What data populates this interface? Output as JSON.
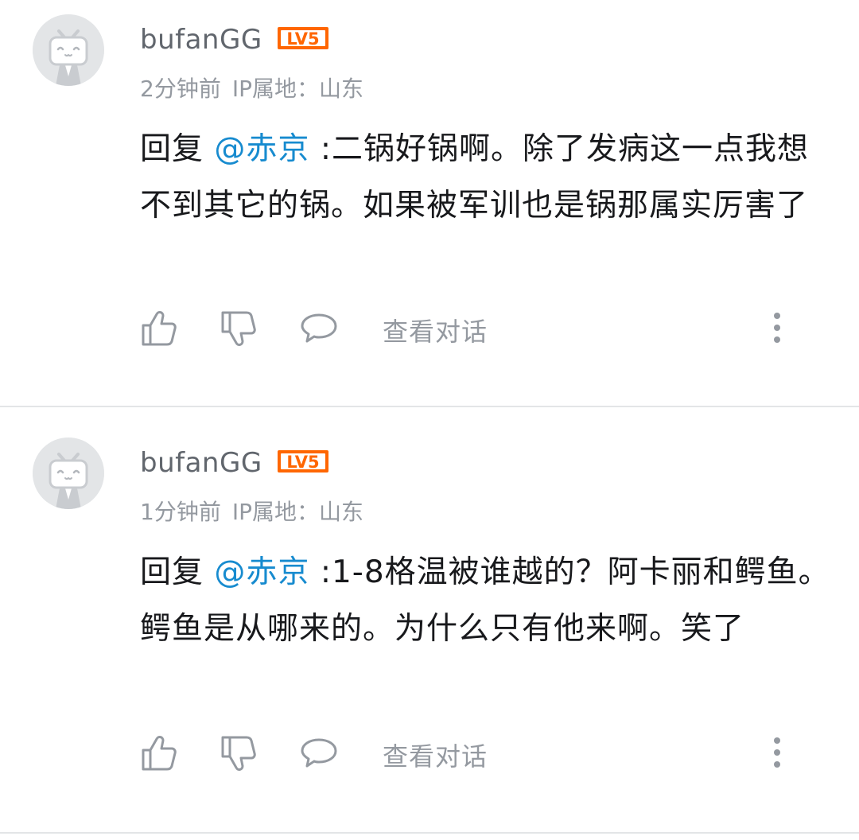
{
  "colors": {
    "mention": "#178bcf",
    "level_badge": "#ff6600",
    "muted": "#9499a0",
    "text": "#18191c"
  },
  "comments": [
    {
      "username": "bufanGG",
      "level_badge": "LV5",
      "avatar_icon": "bilibili-tv-avatar-icon",
      "time": "2分钟前",
      "ip_location": "IP属地：山东",
      "reply_prefix": "回复 ",
      "mention": "@赤京",
      "text": " :二锅好锅啊。除了发病这一点我想不到其它的锅。如果被军训也是锅那属实厉害了",
      "actions": {
        "like_icon": "thumbs-up-icon",
        "dislike_icon": "thumbs-down-icon",
        "reply_icon": "chat-bubble-icon",
        "view_conversation": "查看对话",
        "more_icon": "more-vertical-icon"
      }
    },
    {
      "username": "bufanGG",
      "level_badge": "LV5",
      "avatar_icon": "bilibili-tv-avatar-icon",
      "time": "1分钟前",
      "ip_location": "IP属地：山东",
      "reply_prefix": "回复 ",
      "mention": "@赤京",
      "text": " :1-8格温被谁越的？阿卡丽和鳄鱼。鳄鱼是从哪来的。为什么只有他来啊。笑了",
      "actions": {
        "like_icon": "thumbs-up-icon",
        "dislike_icon": "thumbs-down-icon",
        "reply_icon": "chat-bubble-icon",
        "view_conversation": "查看对话",
        "more_icon": "more-vertical-icon"
      }
    }
  ]
}
